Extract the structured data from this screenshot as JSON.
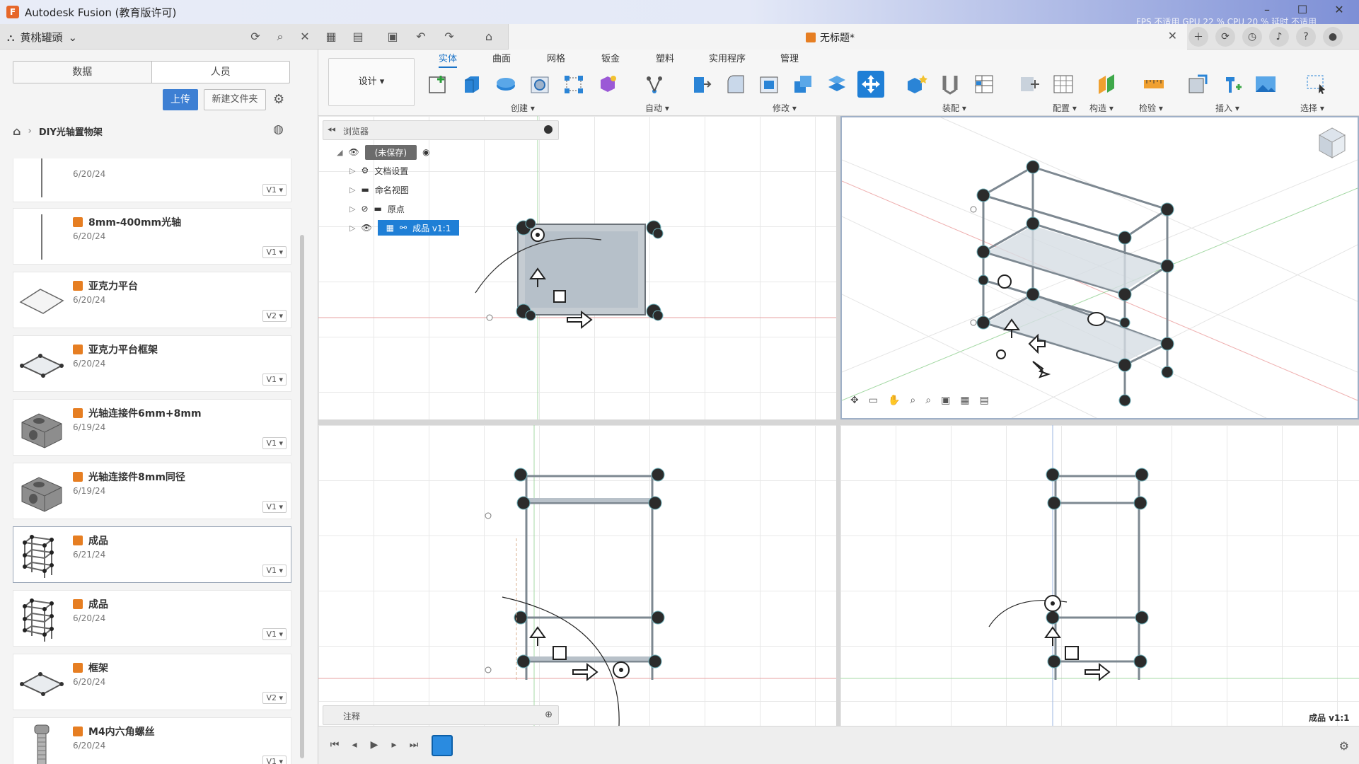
{
  "window": {
    "title": "Autodesk Fusion (教育版许可)",
    "perf_text": "FPS 不适用 GPU 22 % CPU 20 % 延时 不适用"
  },
  "topbar": {
    "team_name": "黄桃罐頭",
    "document_tab": "无标题*"
  },
  "data_panel": {
    "tabs": [
      "数据",
      "人员"
    ],
    "upload_label": "上传",
    "new_folder_label": "新建文件夹",
    "breadcrumb": "DIY光轴置物架",
    "files": [
      {
        "name": "",
        "date": "6/20/24",
        "version": "V1 ▾",
        "thumb": "rod"
      },
      {
        "name": "8mm-400mm光轴",
        "date": "6/20/24",
        "version": "V1 ▾",
        "thumb": "rod"
      },
      {
        "name": "亚克力平台",
        "date": "6/20/24",
        "version": "V2 ▾",
        "thumb": "plate"
      },
      {
        "name": "亚克力平台框架",
        "date": "6/20/24",
        "version": "V1 ▾",
        "thumb": "frame"
      },
      {
        "name": "光轴连接件6mm+8mm",
        "date": "6/19/24",
        "version": "V1 ▾",
        "thumb": "block"
      },
      {
        "name": "光轴连接件8mm同径",
        "date": "6/19/24",
        "version": "V1 ▾",
        "thumb": "block"
      },
      {
        "name": "成品",
        "date": "6/21/24",
        "version": "V1 ▾",
        "thumb": "rack"
      },
      {
        "name": "成品",
        "date": "6/20/24",
        "version": "V1 ▾",
        "thumb": "rack"
      },
      {
        "name": "框架",
        "date": "6/20/24",
        "version": "V2 ▾",
        "thumb": "frame"
      },
      {
        "name": "M4内六角螺丝",
        "date": "6/20/24",
        "version": "V1 ▾",
        "thumb": "screw"
      }
    ]
  },
  "toolbar": {
    "design_label": "设计 ▾",
    "tabs": [
      "实体",
      "曲面",
      "网格",
      "钣金",
      "塑料",
      "实用程序",
      "管理"
    ],
    "groups": {
      "create": "创建 ▾",
      "automate": "自动 ▾",
      "modify": "修改 ▾",
      "assemble": "装配 ▾",
      "configure": "配置 ▾",
      "construct": "构造 ▾",
      "inspect": "检验 ▾",
      "insert": "插入 ▾",
      "select": "选择 ▾"
    }
  },
  "browser": {
    "title": "浏览器",
    "root": "(未保存)",
    "items": [
      "文档设置",
      "命名视图",
      "原点",
      "成品 v1:1"
    ]
  },
  "notes_label": "注释",
  "viewport_label": "成品 v1:1",
  "colors": {
    "accent": "#1f7fd6",
    "file_icon": "#e67e22",
    "app_logo": "#e6672a"
  }
}
